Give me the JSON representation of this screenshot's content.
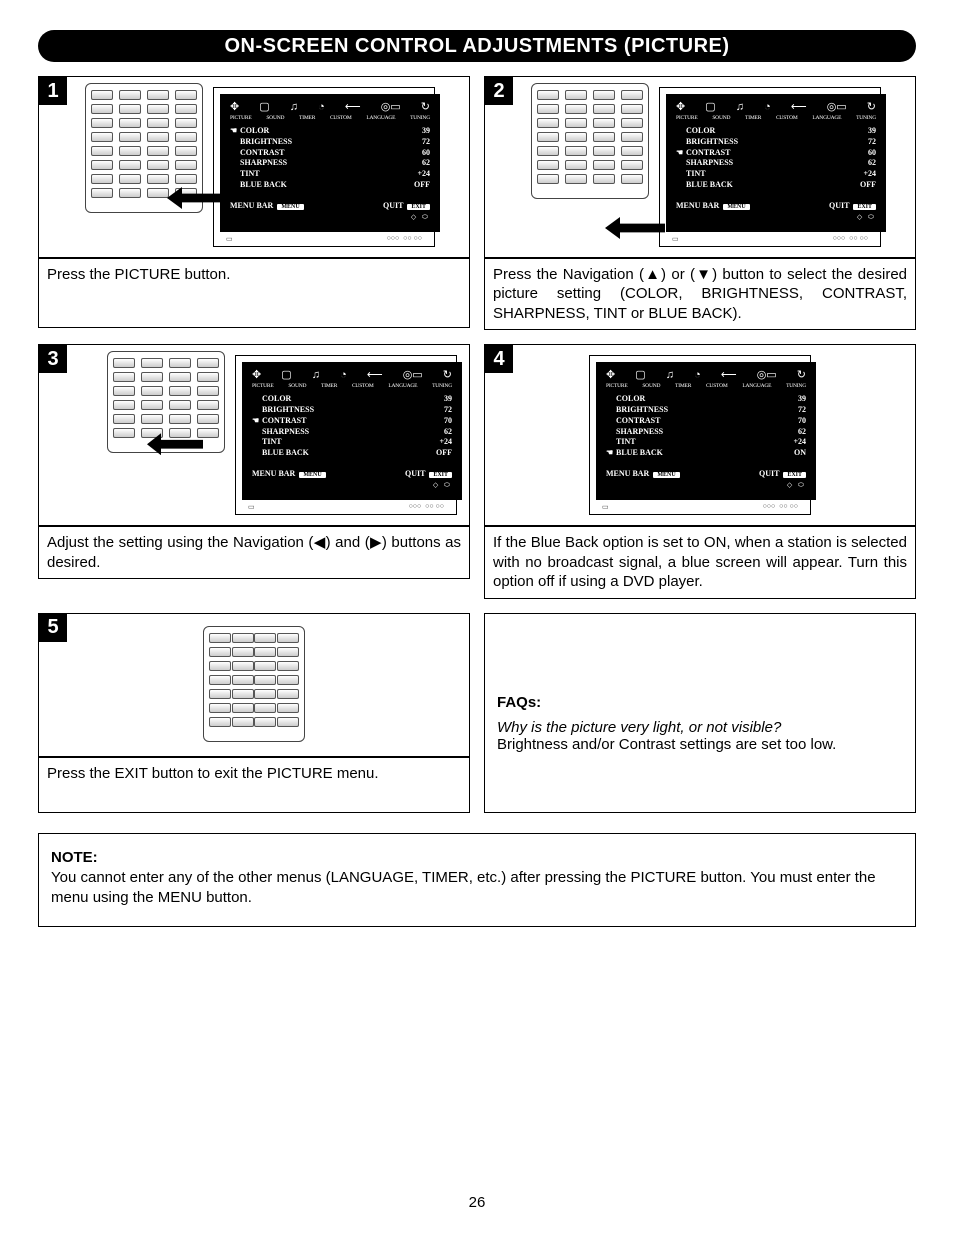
{
  "header": {
    "title": "ON-SCREEN CONTROL ADJUSTMENTS (PICTURE)"
  },
  "menu_tabs": [
    "PICTURE",
    "SOUND",
    "TIMER",
    "CUSTOM",
    "LANGUAGE",
    "TUNING"
  ],
  "rows_labels": [
    "COLOR",
    "BRIGHTNESS",
    "CONTRAST",
    "SHARPNESS",
    "TINT",
    "BLUE BACK"
  ],
  "bottom": {
    "menubar": "MENU BAR",
    "menu": "MENU",
    "quit": "QUIT",
    "exit": "EXIT"
  },
  "steps": {
    "s1": {
      "num": "1",
      "values": [
        "39",
        "72",
        "60",
        "62",
        "+24",
        "OFF"
      ],
      "pointer_index": 0,
      "caption": "Press the PICTURE button."
    },
    "s2": {
      "num": "2",
      "values": [
        "39",
        "72",
        "60",
        "62",
        "+24",
        "OFF"
      ],
      "pointer_index": 2,
      "caption": "Press the Navigation (▲) or (▼) button to select the desired picture setting (COLOR, BRIGHTNESS, CONTRAST, SHARPNESS, TINT or BLUE BACK)."
    },
    "s3": {
      "num": "3",
      "values": [
        "39",
        "72",
        "70",
        "62",
        "+24",
        "OFF"
      ],
      "pointer_index": 2,
      "caption": "Adjust the setting using the Navigation (◀) and (▶) buttons as desired."
    },
    "s4": {
      "num": "4",
      "values": [
        "39",
        "72",
        "70",
        "62",
        "+24",
        "ON"
      ],
      "pointer_index": 5,
      "caption": "If the Blue Back option is set to ON, when a station is selected with no broadcast signal, a blue screen will appear. Turn this option off if using a DVD player."
    },
    "s5": {
      "num": "5",
      "caption": "Press the EXIT button to exit the PICTURE menu."
    }
  },
  "faq": {
    "heading": "FAQs:",
    "q": "Why is the picture very light, or not visible?",
    "a": "Brightness and/or Contrast settings are set too low."
  },
  "note": {
    "heading": "NOTE:",
    "body": "You cannot enter any of the other menus (LANGUAGE, TIMER, etc.) after pressing the PICTURE button. You must enter the menu using the MENU button."
  },
  "page_number": "26"
}
